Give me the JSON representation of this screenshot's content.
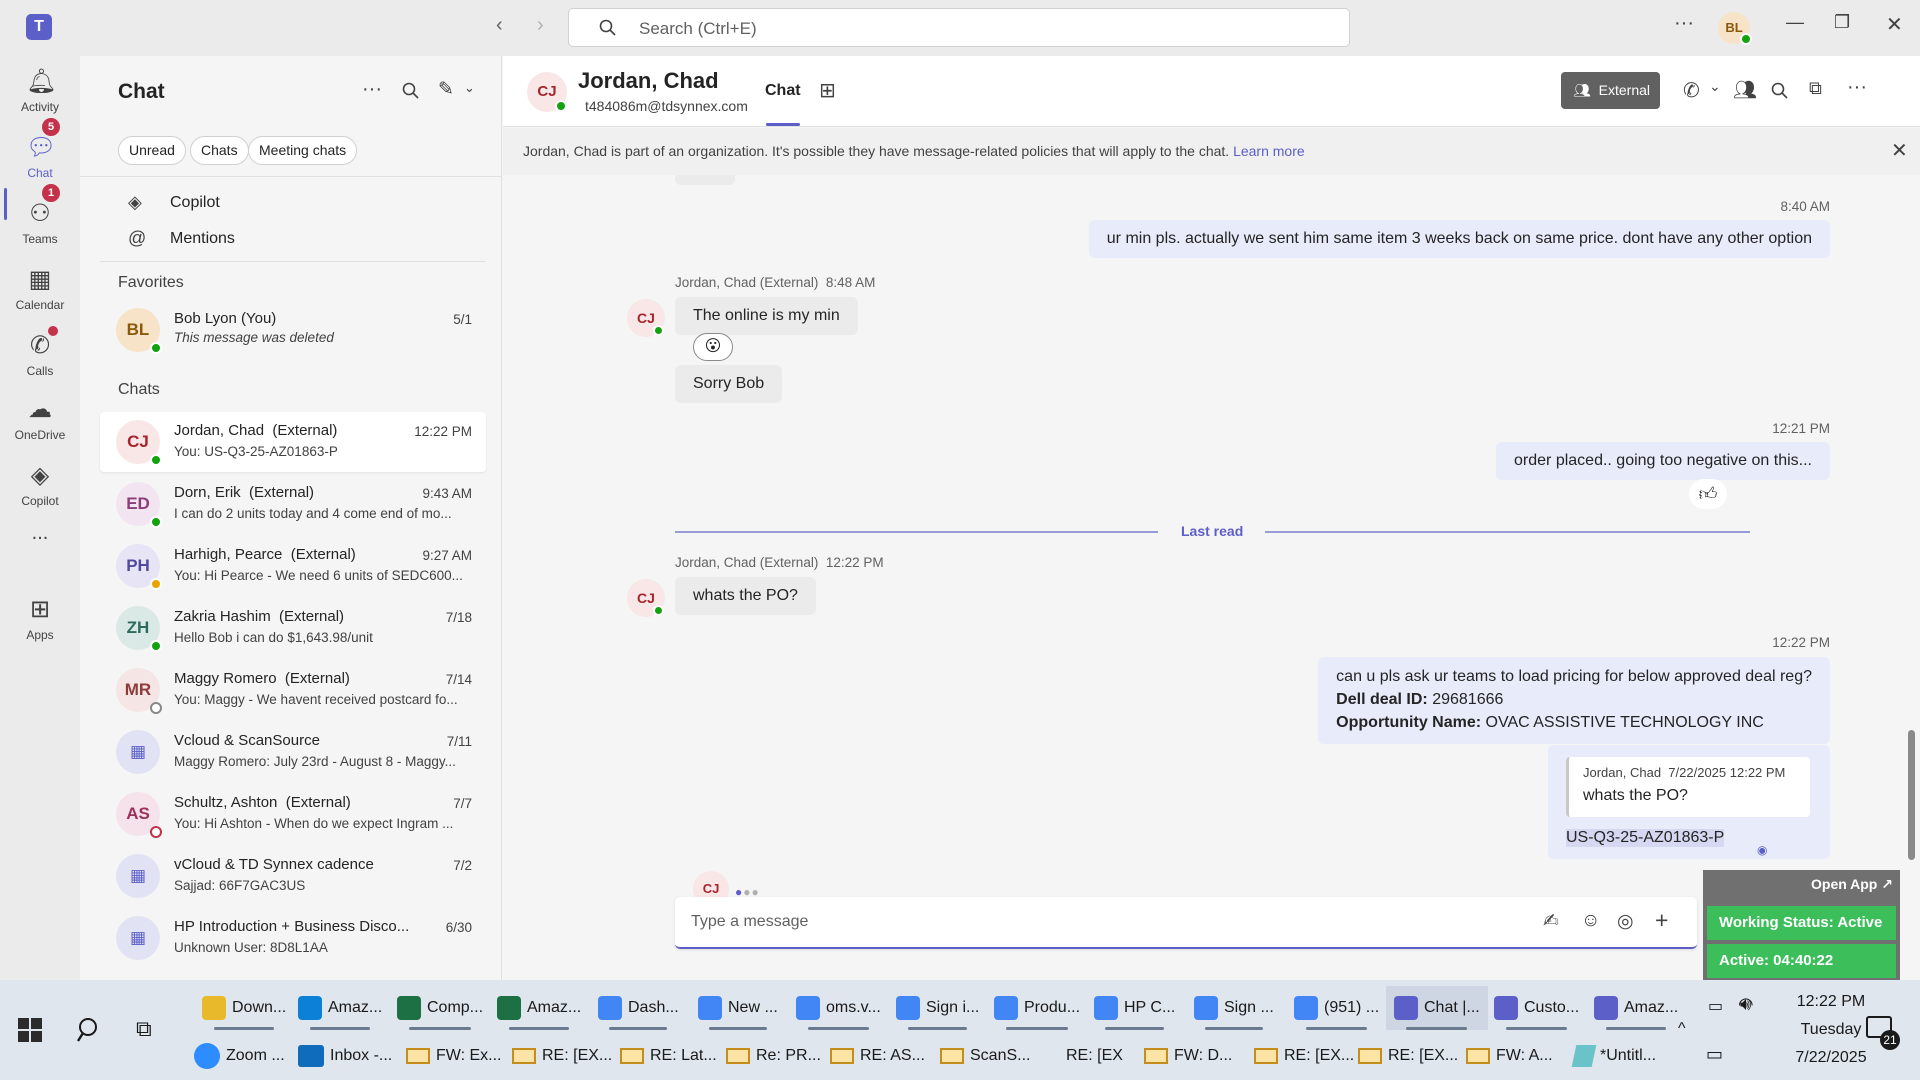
{
  "titlebar": {
    "search_placeholder": "Search (Ctrl+E)",
    "user_initials": "BL"
  },
  "rail": {
    "items": [
      {
        "label": "Activity",
        "badge": "5"
      },
      {
        "label": "Chat",
        "badge": "1"
      },
      {
        "label": "Teams"
      },
      {
        "label": "Calendar"
      },
      {
        "label": "Calls"
      },
      {
        "label": "OneDrive"
      },
      {
        "label": "Copilot"
      },
      {
        "label": "..."
      },
      {
        "label": "Apps"
      }
    ]
  },
  "chatlist": {
    "title": "Chat",
    "filters": [
      "Unread",
      "Chats",
      "Meeting chats"
    ],
    "pinned": [
      "Copilot",
      "Mentions"
    ],
    "favorites_header": "Favorites",
    "favorites": [
      {
        "initials": "BL",
        "name": "Bob Lyon (You)",
        "preview": "This message was deleted",
        "time": "5/1"
      }
    ],
    "chats_header": "Chats",
    "chats": [
      {
        "initials": "CJ",
        "name": "Jordan, Chad",
        "ext": "(External)",
        "preview": "You: US-Q3-25-AZ01863-P",
        "time": "12:22 PM",
        "selected": true
      },
      {
        "initials": "ED",
        "name": "Dorn, Erik",
        "ext": "(External)",
        "preview": "I can do 2 units today and 4 come end of mo...",
        "time": "9:43 AM"
      },
      {
        "initials": "PH",
        "name": "Harhigh, Pearce",
        "ext": "(External)",
        "preview": "You: Hi Pearce -  We need 6 units of SEDC600...",
        "time": "9:27 AM"
      },
      {
        "initials": "ZH",
        "name": "Zakria Hashim",
        "ext": "(External)",
        "preview": "Hello Bob i can do $1,643.98/unit",
        "time": "7/18"
      },
      {
        "initials": "MR",
        "name": "Maggy Romero",
        "ext": "(External)",
        "preview": "You: Maggy - We havent received postcard fo...",
        "time": "7/14"
      },
      {
        "initials": "",
        "name": "Vcloud & ScanSource",
        "ext": "",
        "preview": "Maggy Romero: July 23rd - August 8 - Maggy...",
        "time": "7/11"
      },
      {
        "initials": "AS",
        "name": "Schultz, Ashton",
        "ext": "(External)",
        "preview": "You: Hi Ashton -  When do we expect Ingram ...",
        "time": "7/7"
      },
      {
        "initials": "",
        "name": "vCloud & TD Synnex cadence",
        "ext": "",
        "preview": "Sajjad: 66F7GAC3US",
        "time": "7/2"
      },
      {
        "initials": "",
        "name": "HP Introduction + Business Disco...",
        "ext": "",
        "preview": "Unknown User: 8D8L1AA",
        "time": "6/30"
      }
    ]
  },
  "header": {
    "initials": "CJ",
    "name": "Jordan, Chad",
    "email": "t484086m@tdsynnex.com",
    "tab_chat": "Chat",
    "external_label": "External"
  },
  "banner": {
    "text": "Jordan, Chad is part of an organization. It's possible they have message-related policies that will apply to the chat.",
    "link": "Learn more"
  },
  "messages": {
    "t1": "8:40 AM",
    "m1": "ur min pls. actually we sent him same item 3 weeks back on same price. dont have any other option",
    "sender1": "Jordan, Chad (External)",
    "t2": "8:48 AM",
    "m2": "The online is my min",
    "m3": "Sorry Bob",
    "t3": "12:21 PM",
    "m4": "order placed.. going too negative on this...",
    "last_read": "Last read",
    "sender2": "Jordan, Chad (External)",
    "t4": "12:22 PM",
    "m5": "whats the PO?",
    "t5": "12:22 PM",
    "m6_line1": "can u pls ask ur teams to load pricing for below approved deal reg?",
    "m6_deal_label": "Dell deal ID:",
    "m6_deal_value": "29681666",
    "m6_opp_label": "Opportunity Name:",
    "m6_opp_value": "OVAC ASSISTIVE TECHNOLOGY INC",
    "quote_sender": "Jordan, Chad",
    "quote_time": "7/22/2025 12:22 PM",
    "quote_text": "whats the PO?",
    "m7": "US-Q3-25-AZ01863-P",
    "typing_initials": "CJ"
  },
  "composer": {
    "placeholder": "Type a message"
  },
  "overlay": {
    "open_app": "Open App ↗",
    "status": "Working Status: Active",
    "active": "Active: 04:40:22"
  },
  "taskbar": {
    "row1": [
      {
        "label": "Down...",
        "color": "#e8b92a"
      },
      {
        "label": "Amaz...",
        "color": "#0c7fd6"
      },
      {
        "label": "Comp...",
        "color": "#1d7044"
      },
      {
        "label": "Amaz...",
        "color": "#1d7044"
      },
      {
        "label": "Dash...",
        "color": "#4285f4"
      },
      {
        "label": "New ...",
        "color": "#4285f4"
      },
      {
        "label": "oms.v...",
        "color": "#4285f4"
      },
      {
        "label": "Sign i...",
        "color": "#4285f4"
      },
      {
        "label": "Produ...",
        "color": "#4285f4"
      },
      {
        "label": "HP C...",
        "color": "#4285f4"
      },
      {
        "label": "Sign ...",
        "color": "#4285f4"
      },
      {
        "label": "(951) ...",
        "color": "#4285f4"
      },
      {
        "label": "Chat |...",
        "color": "#5b5fc7"
      },
      {
        "label": "Custo...",
        "color": "#5b5fc7"
      },
      {
        "label": "Amaz...",
        "color": "#5b5fc7"
      }
    ],
    "row2": [
      {
        "label": "Zoom ...",
        "kind": "zoom"
      },
      {
        "label": "Inbox -...",
        "kind": "outlook"
      },
      {
        "label": "FW: Ex...",
        "kind": "mail"
      },
      {
        "label": "RE: [EX...",
        "kind": "mail"
      },
      {
        "label": "RE: Lat...",
        "kind": "mail"
      },
      {
        "label": "Re: PR...",
        "kind": "mail"
      },
      {
        "label": "RE: AS...",
        "kind": "mail"
      },
      {
        "label": "ScanS...",
        "kind": "mail"
      },
      {
        "label": "RE: [EX",
        "kind": "none"
      },
      {
        "label": "FW: D...",
        "kind": "mail"
      },
      {
        "label": "RE: [EX...",
        "kind": "mail"
      },
      {
        "label": "RE: [EX...",
        "kind": "mail"
      },
      {
        "label": "FW: A...",
        "kind": "mail"
      },
      {
        "label": "*Untitl...",
        "kind": "note"
      }
    ],
    "clock_time": "12:22 PM",
    "clock_day": "Tuesday",
    "clock_date": "7/22/2025",
    "notif_count": "21"
  }
}
